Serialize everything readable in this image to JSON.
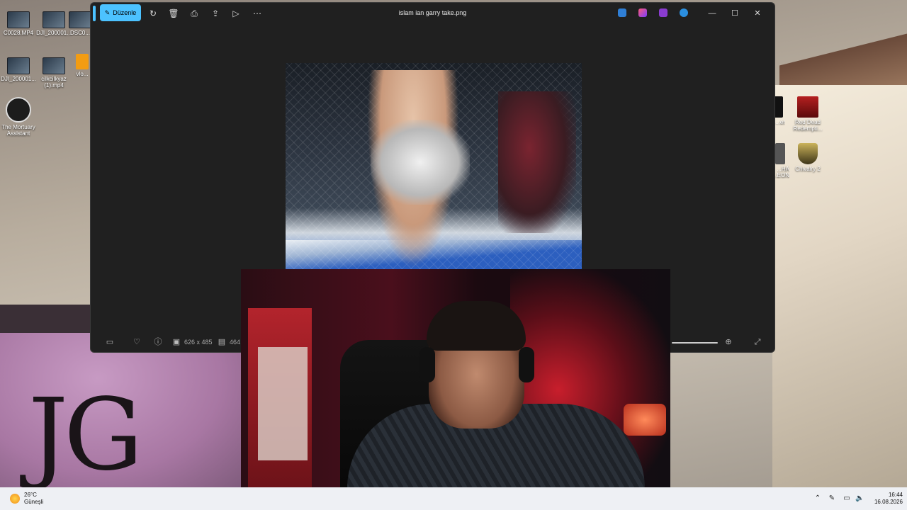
{
  "desktop": {
    "icons_left": [
      {
        "label": "C0028.MP4"
      },
      {
        "label": "DJI_200001..."
      },
      {
        "label": "DSC0..."
      },
      {
        "label": "DJI_200001..."
      },
      {
        "label": "cilkcilkyaz (1).mp4"
      },
      {
        "label": "vlo..."
      },
      {
        "label": "The Mortuary Assistant"
      }
    ],
    "icons_right": [
      {
        "label": "Red Dead Redempti..."
      },
      {
        "label": "Chivalry 2"
      },
      {
        "label": "...er"
      },
      {
        "label": "...HA ...EON"
      }
    ]
  },
  "photos_window": {
    "title": "islam ian garry take.png",
    "edit_label": "Düzenle",
    "image_info": {
      "dimensions": "626 x 485",
      "size": "464"
    },
    "accent_color": "#4cc2ff"
  },
  "taskbar": {
    "weather": {
      "temp": "26°C",
      "condition": "Güneşli"
    },
    "clock": {
      "time": "16:44",
      "date": "16.08.2026"
    }
  }
}
